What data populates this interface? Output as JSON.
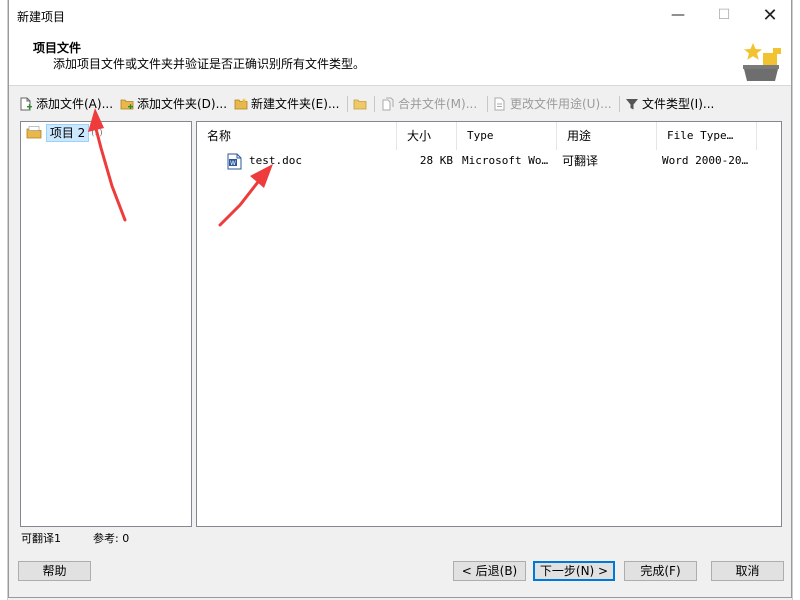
{
  "window": {
    "title": "新建项目",
    "min_glyph": "—",
    "max_glyph": "☐",
    "close_glyph": "✕"
  },
  "header": {
    "title": "项目文件",
    "subtitle": "添加项目文件或文件夹并验证是否正确识别所有文件类型。"
  },
  "toolbar": {
    "add_file": "添加文件(A)...",
    "add_folder": "添加文件夹(D)...",
    "new_folder": "新建文件夹(E)...",
    "merge_files": "合并文件(M)...",
    "change_usage": "更改文件用途(U)...",
    "file_types": "文件类型(I)..."
  },
  "tree": {
    "item_label": "项目 2",
    "item_count": "(1)"
  },
  "list": {
    "columns": [
      "名称",
      "大小",
      "Type",
      "用途",
      "File Type…"
    ],
    "rows": [
      {
        "name": "test.doc",
        "size": "28 KB",
        "type": "Microsoft Wo…",
        "usage": "可翻译",
        "file_type": "Word 2000-20…"
      }
    ]
  },
  "status": {
    "translatable": "可翻译1",
    "reference": "参考: 0"
  },
  "buttons": {
    "help": "帮助",
    "back": "< 后退(B)",
    "next": "下一步(N) >",
    "finish": "完成(F)",
    "cancel": "取消"
  },
  "colors": {
    "accent": "#0078d7",
    "annotation_arrow": "#ee3b3b",
    "selection": "#cce8ff"
  }
}
